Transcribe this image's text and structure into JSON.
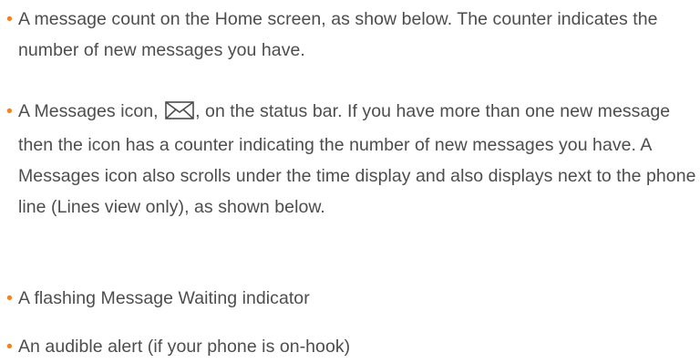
{
  "bullet_color": "#f58220",
  "text_color": "#4d4d4d",
  "items": [
    {
      "text": "A message count on the Home screen, as show below. The counter indicates the number of new messages you have."
    },
    {
      "text_before_icon": "A Messages icon,",
      "icon": "envelope-icon",
      "text_after_icon": ", on the status bar. If you have more than one new message then the icon has a counter indicating the number of new messages you have. A Messages icon also scrolls under the time display and also displays next to the phone line (Lines view only), as shown below."
    },
    {
      "text": "A flashing Message Waiting indicator"
    },
    {
      "text": "An audible alert (if your phone is on-hook)"
    }
  ]
}
